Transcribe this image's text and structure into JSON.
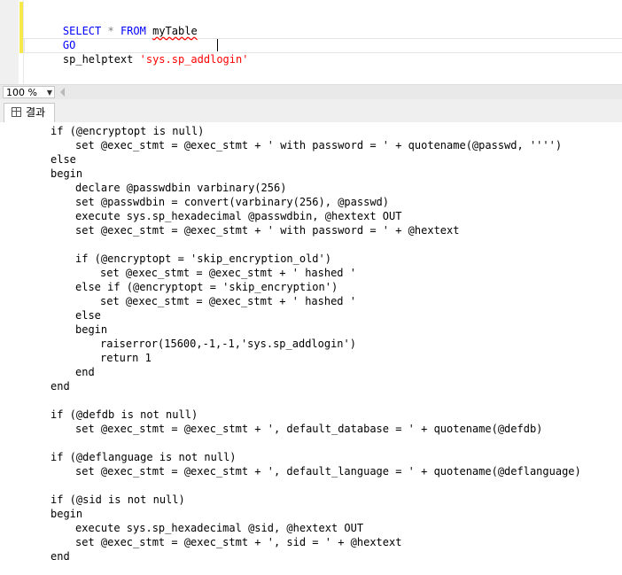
{
  "editor": {
    "lines": [
      {
        "kw1": "SELECT",
        "mid": " * ",
        "kw2": "FROM",
        "name": "myTable"
      },
      {
        "kw": "GO"
      },
      {
        "proc": "sp_helptext",
        "space": " ",
        "str": "'sys.sp_addlogin'"
      }
    ]
  },
  "zoom": {
    "value": "100 %"
  },
  "tabs": {
    "results_label": "결과"
  },
  "results": {
    "lines": [
      {
        "indent": 1,
        "text": "if (@encryptopt is null)"
      },
      {
        "indent": 2,
        "text": "set @exec_stmt = @exec_stmt + ' with password = ' + quotename(@passwd, '''')"
      },
      {
        "indent": 1,
        "text": "else"
      },
      {
        "indent": 1,
        "text": "begin"
      },
      {
        "indent": 2,
        "text": "declare @passwdbin varbinary(256)"
      },
      {
        "indent": 2,
        "text": "set @passwdbin = convert(varbinary(256), @passwd)"
      },
      {
        "indent": 2,
        "text": "execute sys.sp_hexadecimal @passwdbin, @hextext OUT"
      },
      {
        "indent": 2,
        "text": "set @exec_stmt = @exec_stmt + ' with password = ' + @hextext"
      },
      {
        "indent": 0,
        "text": ""
      },
      {
        "indent": 2,
        "text": "if (@encryptopt = 'skip_encryption_old')"
      },
      {
        "indent": 3,
        "text": "set @exec_stmt = @exec_stmt + ' hashed '"
      },
      {
        "indent": 2,
        "text": "else if (@encryptopt = 'skip_encryption')"
      },
      {
        "indent": 3,
        "text": "set @exec_stmt = @exec_stmt + ' hashed '"
      },
      {
        "indent": 2,
        "text": "else"
      },
      {
        "indent": 2,
        "text": "begin"
      },
      {
        "indent": 3,
        "text": "raiserror(15600,-1,-1,'sys.sp_addlogin')"
      },
      {
        "indent": 3,
        "text": "return 1"
      },
      {
        "indent": 2,
        "text": "end"
      },
      {
        "indent": 1,
        "text": "end"
      },
      {
        "indent": 0,
        "text": ""
      },
      {
        "indent": 1,
        "text": "if (@defdb is not null)"
      },
      {
        "indent": 2,
        "text": "set @exec_stmt = @exec_stmt + ', default_database = ' + quotename(@defdb)"
      },
      {
        "indent": 0,
        "text": ""
      },
      {
        "indent": 1,
        "text": "if (@deflanguage is not null)"
      },
      {
        "indent": 2,
        "text": "set @exec_stmt = @exec_stmt + ', default_language = ' + quotename(@deflanguage)"
      },
      {
        "indent": 0,
        "text": ""
      },
      {
        "indent": 1,
        "text": "if (@sid is not null)"
      },
      {
        "indent": 1,
        "text": "begin"
      },
      {
        "indent": 2,
        "text": "execute sys.sp_hexadecimal @sid, @hextext OUT"
      },
      {
        "indent": 2,
        "text": "set @exec_stmt = @exec_stmt + ', sid = ' + @hextext"
      },
      {
        "indent": 1,
        "text": "end"
      }
    ]
  }
}
